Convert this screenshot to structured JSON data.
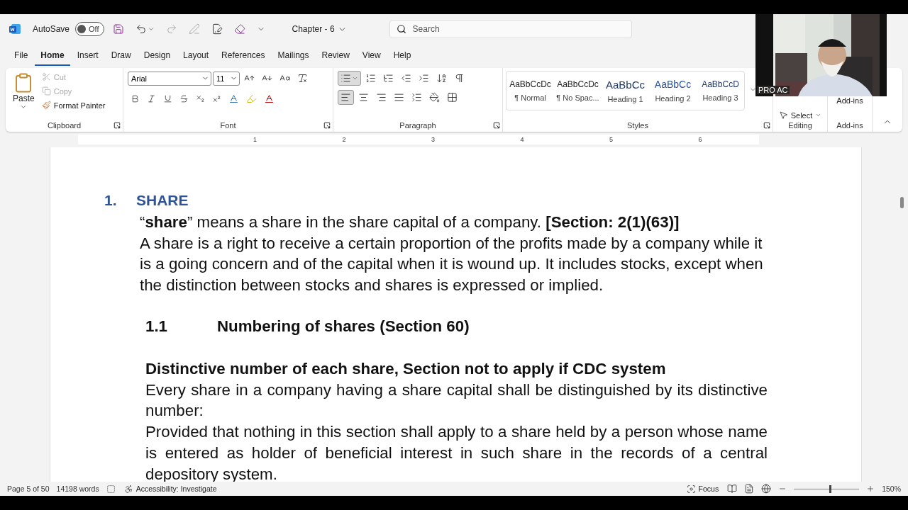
{
  "title_bar": {
    "autosave_label": "AutoSave",
    "autosave": {
      "label": "Off",
      "on": false
    },
    "document_title": "Chapter - 6",
    "search": {
      "placeholder": "Search"
    }
  },
  "tabs": [
    {
      "label": "File",
      "selected": false
    },
    {
      "label": "Home",
      "selected": true
    },
    {
      "label": "Insert",
      "selected": false
    },
    {
      "label": "Draw",
      "selected": false
    },
    {
      "label": "Design",
      "selected": false
    },
    {
      "label": "Layout",
      "selected": false
    },
    {
      "label": "References",
      "selected": false
    },
    {
      "label": "Mailings",
      "selected": false
    },
    {
      "label": "Review",
      "selected": false
    },
    {
      "label": "View",
      "selected": false
    },
    {
      "label": "Help",
      "selected": false
    }
  ],
  "ribbon": {
    "clipboard": {
      "paste": "Paste",
      "cut": {
        "label": "Cut",
        "disabled": true
      },
      "copy": {
        "label": "Copy",
        "disabled": true
      },
      "format_painter": "Format Painter",
      "group": "Clipboard"
    },
    "font": {
      "name": "Arial",
      "size": "11",
      "group": "Font"
    },
    "paragraph": {
      "bullets": {
        "on": true
      },
      "alignments": [
        {
          "kind": "left",
          "selected": true
        },
        {
          "kind": "center",
          "selected": false
        },
        {
          "kind": "right",
          "selected": false
        },
        {
          "kind": "justify",
          "selected": false
        }
      ],
      "group": "Paragraph"
    },
    "styles": {
      "items": [
        {
          "preview": "AaBbCcDc",
          "label": "¶ Normal",
          "kind": "body"
        },
        {
          "preview": "AaBbCcDc",
          "label": "¶ No Spac...",
          "kind": "body"
        },
        {
          "preview": "AaBbCc",
          "label": "Heading 1",
          "kind": "heading1"
        },
        {
          "preview": "AaBbCc",
          "label": "Heading 2",
          "kind": "heading2"
        },
        {
          "preview": "AaBbCcD",
          "label": "Heading 3",
          "kind": "heading3"
        }
      ],
      "group": "Styles"
    },
    "editing": {
      "select": "Select",
      "group": "Editing"
    },
    "addins": {
      "button": "Add-ins",
      "group": "Add-ins"
    }
  },
  "ruler": {
    "numbers": [
      "1",
      "2",
      "3",
      "4",
      "5",
      "6"
    ]
  },
  "document": {
    "blocks": [
      {
        "kind": "heading1",
        "number": "1.",
        "text": "SHARE"
      },
      {
        "kind": "para",
        "text": "“**share**” means a share in the share capital of a company. **[Section: 2(1)(63)]**"
      },
      {
        "kind": "para",
        "text": "A share is a right to receive a certain proportion of the profits made by a company while it is a going concern and of the capital when it is wound up. It includes stocks, except when the distinction between stocks and shares is expressed or implied."
      },
      {
        "kind": "heading2",
        "number": "1.1",
        "text": "Numbering of shares (Section 60)"
      },
      {
        "kind": "bold",
        "text": "Distinctive number of each share, Section not to apply if CDC system"
      },
      {
        "kind": "body",
        "text": "Every share in a company having a share capital shall be distinguished by its distinctive number:"
      },
      {
        "kind": "body",
        "text": "Provided that nothing in this section shall apply to a share held by a person whose name is entered as holder of beneficial interest in such share in the records of a central depository system."
      }
    ]
  },
  "video": {
    "caption": "PRO AC"
  },
  "status_bar": {
    "page": "Page 5 of 50",
    "words": "14198 words",
    "accessibility": "Accessibility: Investigate",
    "focus": "Focus",
    "zoom": "150%",
    "zoom_slider": {
      "level": 0.55
    }
  }
}
